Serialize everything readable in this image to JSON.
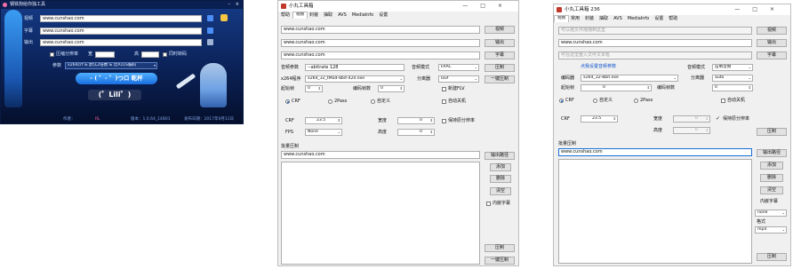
{
  "left": {
    "title": "钢铁狗给你独工具",
    "labels": [
      "视频",
      "字幕",
      "输出"
    ],
    "inputs": [
      "www.cunshao.com",
      "www.cunshao.com",
      "www.cunshao.com"
    ],
    "checkbox1": "压缩分辨率",
    "w_label": "宽",
    "h_label": "高",
    "checkbox2": "同时转码",
    "params_label": "参数",
    "preset_value": "x264crf & 默认2倍数 & 比A1LS编码",
    "go_button": "- ( ゜- ゜)つロ 乾杯",
    "logo": "(゜Lili゜)",
    "footer_author": "作者：",
    "footer_name": "RL",
    "footer_version": "版本：1.0.64_14B01",
    "footer_date": "发布日期：2017年9月11日"
  },
  "middle": {
    "title": "小丸工具箱",
    "menu": [
      "帮助",
      "视频",
      "音频",
      "封装",
      "抽取",
      "AVS",
      "MediaInfo",
      "设置"
    ],
    "video_input": "www.cunshao.com",
    "output_input": "www.cunshao.com",
    "sub_input": "www.cunshao.com",
    "btn_video": "视频",
    "btn_output": "输出",
    "btn_sub": "字幕",
    "audio_param_label": "音频参数",
    "audio_param_value": "--abitrate 128",
    "audio_mode_label": "音频模式",
    "audio_mode_value": "FAAC",
    "btn_compress": "压制",
    "x264_label": "x264程序",
    "x264_value": "x264_32_tMod-8bit-420.exe",
    "splitter_label": "分离器",
    "splitter_value": "lavf",
    "btn_onekey": "一键压制",
    "start_frame_label": "起始帧",
    "start_frame": "0",
    "encode_frames_label": "编码帧数",
    "encode_frames": "0",
    "chk_flv": "新建FLV",
    "chk_shutdown": "自动关机",
    "mode_crf": "CRF",
    "mode_2pass": "2Pass",
    "mode_custom": "自定义",
    "crf_label": "CRF",
    "crf_value": "23.5",
    "fps_label": "FPS",
    "fps_value": "None",
    "width_label": "宽度",
    "width_value": "0",
    "height_label": "高度",
    "height_value": "0",
    "keep_res": "保持原分辨率",
    "batch_label": "批量压制",
    "batch_input": "www.cunshao.com",
    "btn_out_path": "输出路径",
    "btn_add": "添加",
    "btn_delete": "删除",
    "btn_clear": "清空",
    "chk_inner_sub": "内嵌字幕",
    "btn_compress2": "压制",
    "btn_onekey2": "一键压制"
  },
  "right": {
    "title": "小丸工具箱 236",
    "menu": [
      "视频",
      "音频",
      "常用",
      "封装",
      "抽取",
      "AVS",
      "MediaInfo",
      "设置",
      "帮助"
    ],
    "video_placeholder": "可以拖文件拖拽到这里",
    "output_input": "www.cunshao.com",
    "sub_placeholder": "可在这里重入文件文本框",
    "btn_video": "视频",
    "btn_output": "输出",
    "btn_sub": "字幕",
    "audio_link": "点我设置音频参数",
    "audio_mode_label": "音频模式",
    "audio_mode_value": "压制音频",
    "encoder_label": "编码器",
    "encoder_value": "x264_32-8bit.exe",
    "splitter_label": "分离器",
    "splitter_value": "auto",
    "start_frame_label": "起始帧",
    "start_frame": "0",
    "encode_frames_label": "编码帧数",
    "encode_frames": "0",
    "chk_shutdown": "自动关机",
    "mode_crf": "CRF",
    "mode_custom": "自定义",
    "mode_2pass": "2Pass",
    "crf_label": "CRF",
    "crf_value": "23.5",
    "width_label": "宽度",
    "width_value": "0",
    "height_label": "高度",
    "height_value": "0",
    "keep_res": "保持原分辨率",
    "btn_compress": "压制",
    "batch_label": "批量压制",
    "batch_input": "www.cunshao.com",
    "btn_out_path": "输出路径",
    "btn_add": "添加",
    "btn_delete": "删除",
    "btn_clear": "清空",
    "inner_sub_label": "内嵌字幕",
    "inner_sub_value": "none",
    "format_label": "格式",
    "format_value": "mp4",
    "btn_compress2": "压制"
  },
  "colors": {
    "left_bg_top": "#0f2c6b",
    "left_bg_bottom": "#071432",
    "accent_blue": "#1e90ff",
    "link_blue": "#1155cc"
  }
}
